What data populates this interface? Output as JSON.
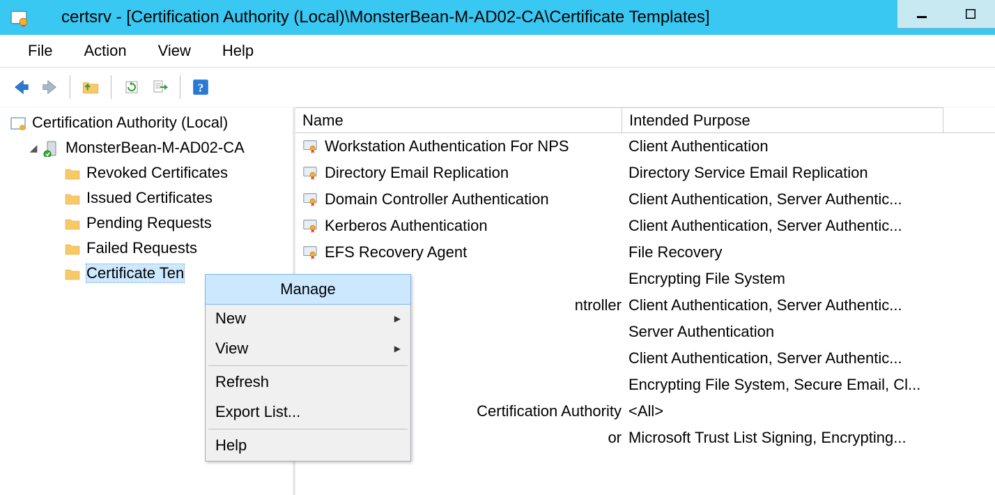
{
  "title": "certsrv - [Certification Authority (Local)\\MonsterBean-M-AD02-CA\\Certificate Templates]",
  "menubar": [
    "File",
    "Action",
    "View",
    "Help"
  ],
  "tree": {
    "root": "Certification Authority (Local)",
    "ca": "MonsterBean-M-AD02-CA",
    "leaves": [
      "Revoked Certificates",
      "Issued Certificates",
      "Pending Requests",
      "Failed Requests",
      "Certificate Templates"
    ],
    "selected_index": 4,
    "selected_visible": "Certificate Ten"
  },
  "columns": {
    "name": "Name",
    "purpose": "Intended Purpose"
  },
  "rows": [
    {
      "name": "Workstation Authentication For NPS",
      "purpose": "Client Authentication"
    },
    {
      "name": "Directory Email Replication",
      "purpose": "Directory Service Email Replication"
    },
    {
      "name": "Domain Controller Authentication",
      "purpose": "Client Authentication, Server Authentic..."
    },
    {
      "name": "Kerberos Authentication",
      "purpose": "Client Authentication, Server Authentic..."
    },
    {
      "name": "EFS Recovery Agent",
      "purpose": "File Recovery"
    },
    {
      "name": "",
      "purpose": "Encrypting File System"
    },
    {
      "name_suffix": "ntroller",
      "purpose": "Client Authentication, Server Authentic..."
    },
    {
      "name": "",
      "purpose": "Server Authentication"
    },
    {
      "name": "",
      "purpose": "Client Authentication, Server Authentic..."
    },
    {
      "name": "",
      "purpose": "Encrypting File System, Secure Email, Cl..."
    },
    {
      "name_suffix": " Certification Authority",
      "purpose": "<All>"
    },
    {
      "name_suffix": "or",
      "purpose": "Microsoft Trust List Signing, Encrypting..."
    }
  ],
  "context_menu": {
    "items": [
      {
        "label": "Manage",
        "hover": true
      },
      {
        "label": "New",
        "submenu": true
      },
      {
        "label": "View",
        "submenu": true
      },
      {
        "divider": true
      },
      {
        "label": "Refresh"
      },
      {
        "label": "Export List..."
      },
      {
        "divider": true
      },
      {
        "label": "Help"
      }
    ]
  }
}
